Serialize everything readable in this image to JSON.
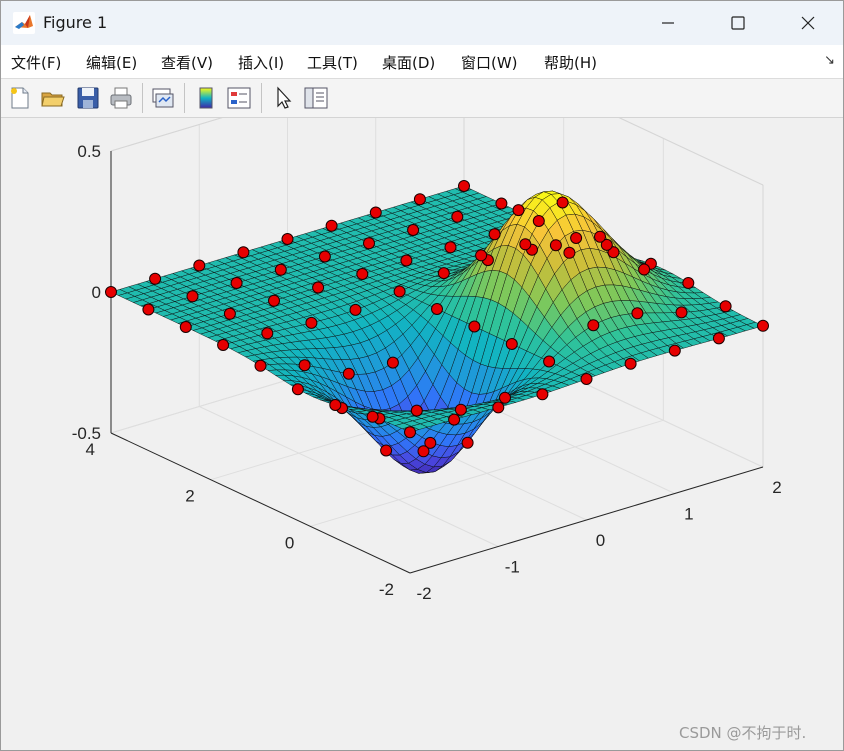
{
  "window": {
    "title": "Figure 1"
  },
  "menu": {
    "items": [
      {
        "label": "文件(F)"
      },
      {
        "label": "编辑(E)"
      },
      {
        "label": "查看(V)"
      },
      {
        "label": "插入(I)"
      },
      {
        "label": "工具(T)"
      },
      {
        "label": "桌面(D)"
      },
      {
        "label": "窗口(W)"
      },
      {
        "label": "帮助(H)"
      }
    ],
    "overflow_arrow": "↘"
  },
  "toolbar": {
    "buttons": [
      {
        "icon": "new-figure-icon"
      },
      {
        "icon": "open-file-icon"
      },
      {
        "icon": "save-icon"
      },
      {
        "icon": "print-icon"
      },
      {
        "icon": "link-plot-icon"
      },
      {
        "icon": "colorbar-icon"
      },
      {
        "icon": "legend-icon"
      },
      {
        "icon": "edit-plot-pointer-icon"
      },
      {
        "icon": "property-inspector-icon"
      }
    ]
  },
  "colors": {
    "surface_cmap": [
      "#3e26a8",
      "#4a47e0",
      "#2f77f9",
      "#1e9bd8",
      "#12b4c2",
      "#2fc39a",
      "#7fc85a",
      "#c8be3a",
      "#f7c43a",
      "#f9fb15"
    ],
    "marker": "#e60000",
    "axis": "#262626",
    "grid": "#dedede",
    "background": "#f0f0f0"
  },
  "chart_data": {
    "type": "surface",
    "title": "",
    "xlabel": "",
    "ylabel": "",
    "zlabel": "",
    "x_ticks": [
      "-2",
      "-1",
      "0",
      "1",
      "2"
    ],
    "y_ticks": [
      "-2",
      "0",
      "2",
      "4"
    ],
    "z_ticks": [
      "-0.5",
      "0",
      "0.5"
    ],
    "xlim": [
      -2,
      2
    ],
    "ylim": [
      -2,
      4
    ],
    "zlim": [
      -0.5,
      0.5
    ],
    "grid": true,
    "view": "3d",
    "surface": "z = x * exp(-x^2 - y^2) sampled on a fine grid, shaded with parula colormap",
    "markers": "coarse data samples of the same function drawn as red filled circles"
  },
  "watermark": "CSDN @不拘于时."
}
